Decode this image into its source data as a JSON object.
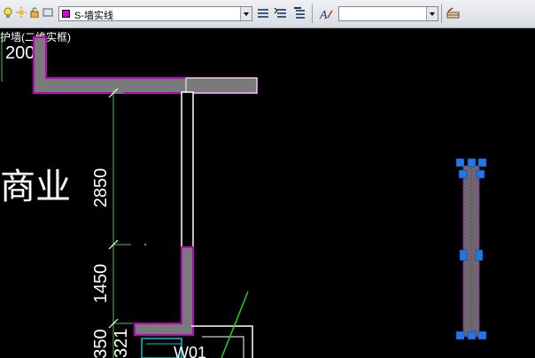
{
  "toolbar": {
    "layer_name": "S-墙实线",
    "layer_color": "#d400d4",
    "textstyle_value": "",
    "icons": [
      "lightbulb-icon",
      "sun-icon",
      "lock-icon",
      "layer-color-swatch",
      "layer-properties-icon",
      "layer-match-icon",
      "layer-previous-icon",
      "text-style-icon",
      "table-style-icon"
    ]
  },
  "drawing": {
    "top_left_label": "护墙(二维实框)",
    "top_dim": "200",
    "side_text": "商业",
    "dims": [
      "2850",
      "1450",
      "350"
    ],
    "bottom_dim_partial": "321",
    "window_label": "W01",
    "colors": {
      "background": "#000000",
      "wall_fill": "#808080",
      "wall_edge_white": "#ffffff",
      "wall_edge_magenta": "#c000c0",
      "dimension_line": "#4cc04c",
      "grip": "#1e78e8",
      "cyan_line": "#00c8c8",
      "green_line": "#22d022"
    }
  }
}
